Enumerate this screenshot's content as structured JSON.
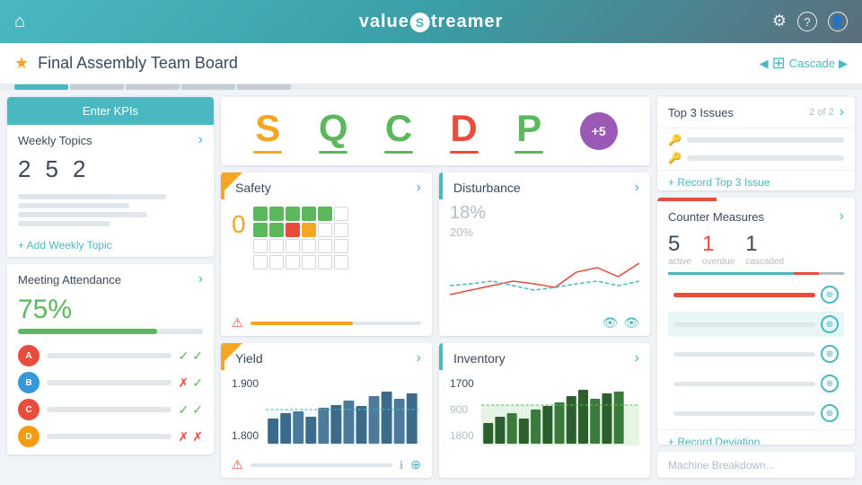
{
  "app": {
    "logo_text": "value",
    "logo_s": "S",
    "logo_suffix": "treamer"
  },
  "header": {
    "home_icon": "⌂",
    "gear_icon": "⚙",
    "help_icon": "?",
    "user_icon": "👤"
  },
  "sub_header": {
    "star_icon": "★",
    "title": "Final Assembly Team Board",
    "cascade_label": "Cascade"
  },
  "left_panel": {
    "enter_kpis_label": "Enter KPIs",
    "weekly_topics_label": "Weekly Topics",
    "num1": "2",
    "num2": "5",
    "num3": "2",
    "add_topic_label": "+ Add Weekly Topic",
    "meeting_attendance_label": "Meeting Attendance",
    "attendance_pct": "75%",
    "attendees": [
      {
        "color": "#e74c3c",
        "checks": [
          "✓",
          "✓"
        ]
      },
      {
        "color": "#3498db",
        "checks": [
          "✗",
          "✓"
        ]
      },
      {
        "color": "#e74c3c",
        "checks": [
          "✓",
          "✓"
        ]
      },
      {
        "color": "#f39c12",
        "checks": [
          "✗",
          "✗"
        ]
      }
    ]
  },
  "sqcdp": {
    "letters": [
      "S",
      "Q",
      "C",
      "D",
      "P"
    ],
    "colors": [
      "#f5a623",
      "#5cb85c",
      "#5cb85c",
      "#e74c3c",
      "#5cb85c"
    ],
    "underline_colors": [
      "#f5a623",
      "#5cb85c",
      "#5cb85c",
      "#e74c3c",
      "#5cb85c"
    ],
    "plus_label": "+5"
  },
  "safety": {
    "title": "Safety",
    "value": "0",
    "value_color": "#f5a623"
  },
  "disturbance": {
    "title": "Disturbance",
    "pct1": "18%",
    "pct2": "20%"
  },
  "yield": {
    "title": "Yield",
    "val1": "1.900",
    "val2": "1.800",
    "bar_data": [
      60,
      50,
      55,
      45,
      65,
      70,
      75,
      65,
      80,
      85,
      90,
      70
    ]
  },
  "inventory": {
    "title": "Inventory",
    "val1": "1700",
    "val2": "900",
    "val3": "1800",
    "bar_data": [
      40,
      55,
      60,
      50,
      65,
      70,
      75,
      80,
      90,
      100,
      85,
      95
    ]
  },
  "top3_issues": {
    "title": "Top 3 Issues",
    "count_label": "2 of 2",
    "record_link": "+ Record Top 3 Issue"
  },
  "counter_measures": {
    "title": "Counter Measures",
    "active_num": "5",
    "active_label": "active",
    "overdue_num": "1",
    "overdue_label": "overdue",
    "cascaded_num": "1",
    "cascaded_label": "cascaded",
    "record_link": "+ Record Deviation"
  }
}
